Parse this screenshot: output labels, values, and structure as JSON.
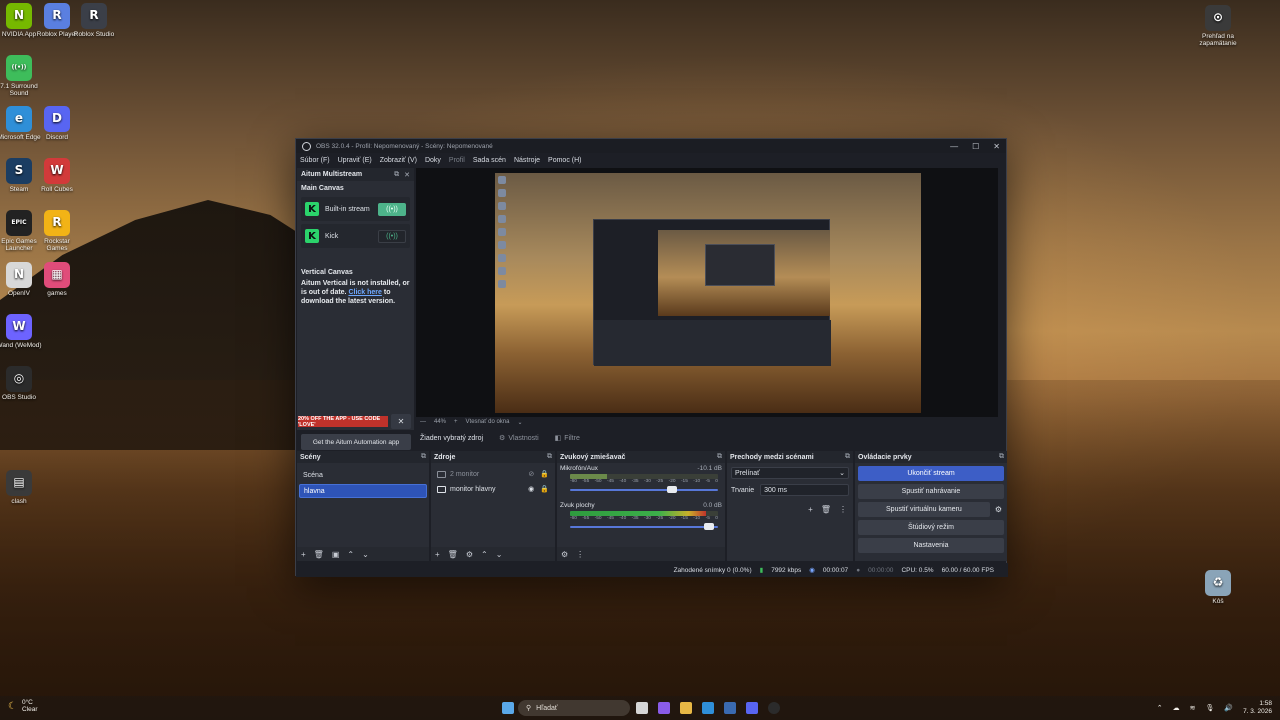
{
  "desktop": {
    "icons_left": [
      {
        "label": "NVIDIA App",
        "glyph": "N",
        "color": "#76b900"
      },
      {
        "label": "Roblox Player",
        "glyph": "R",
        "color": "#5a7fe0"
      },
      {
        "label": "Roblox Studio",
        "glyph": "R",
        "color": "#3b3f48"
      },
      {
        "label": "7.1 Surround Sound",
        "glyph": "((•))",
        "color": "#3ebd5b"
      },
      {
        "label": "Microsoft Edge",
        "glyph": "e",
        "color": "#2f8fd8"
      },
      {
        "label": "Discord",
        "glyph": "D",
        "color": "#5865f2"
      },
      {
        "label": "Steam",
        "glyph": "S",
        "color": "#1b3d62"
      },
      {
        "label": "Roll Cubes",
        "glyph": "W",
        "color": "#d23a3a"
      },
      {
        "label": "Epic Games Launcher",
        "glyph": "EPIC",
        "color": "#222222"
      },
      {
        "label": "Rockstar Games",
        "glyph": "R",
        "color": "#f2b316"
      },
      {
        "label": "OpenIV",
        "glyph": "N",
        "color": "#d8d8d8"
      },
      {
        "label": "games",
        "glyph": "▦",
        "color": "#e04c7a"
      },
      {
        "label": "Wand (WeMod)",
        "glyph": "W",
        "color": "#6d63ff"
      },
      {
        "label": "OBS Studio",
        "glyph": "◎",
        "color": "#2b2b2b"
      },
      {
        "label": "clash",
        "glyph": "▤",
        "color": "#3a3a3a"
      }
    ],
    "icons_right": [
      {
        "label": "Prehľad na zapamätanie",
        "glyph": "⊙",
        "color": "#3a3a3a"
      },
      {
        "label": "Kôš",
        "glyph": "♻",
        "color": "#8aa4b8"
      }
    ]
  },
  "obs": {
    "title": "OBS 32.0.4 - Profil: Nepomenovaný - Scény: Nepomenované",
    "window_controls": [
      "—",
      "☐",
      "✕"
    ],
    "menu": [
      "Súbor (F)",
      "Upraviť (E)",
      "Zobraziť (V)",
      "Doky",
      "Profil",
      "Sada scén",
      "Nástroje",
      "Pomoc (H)"
    ],
    "multistream": {
      "title": "Aitum Multistream",
      "main_canvas": "Main Canvas",
      "outputs": [
        {
          "name": "Built-in stream",
          "active": true,
          "live_icon": "((•))"
        },
        {
          "name": "Kick",
          "active": false,
          "live_icon": "((•))"
        }
      ],
      "vertical_canvas": "Vertical Canvas",
      "vertical_msg": "Aitum Vertical is not installed, or is out of date.",
      "link_text": "Click here",
      "link_rest": "to download the latest version.",
      "promo": "20% OFF THE APP - USE CODE 'LOVE'",
      "promo_close": "✕",
      "get_app": "Get the Aitum Automation app",
      "btns": [
        "⚙",
        "♥",
        "⟲"
      ]
    },
    "zoom": {
      "value": "44%",
      "fit": "Vtesnať do okna"
    },
    "source_bar": {
      "none": "Žiaden vybratý zdroj",
      "properties": "Vlastnosti",
      "filters": "Filtre"
    },
    "scenes": {
      "title": "Scény",
      "items": [
        "Scéna",
        "hlavna"
      ],
      "selected_index": 1,
      "foot": [
        "+",
        "🗑",
        "▣",
        "⌃",
        "⌄"
      ]
    },
    "sources": {
      "title": "Zdroje",
      "items": [
        {
          "name": "2 monitor",
          "hidden": true
        },
        {
          "name": "monitor hlavny",
          "hidden": false
        }
      ],
      "foot": [
        "+",
        "🗑",
        "⚙",
        "⌃",
        "⌄"
      ]
    },
    "mixer": {
      "title": "Zvukový zmiešavač",
      "channels": [
        {
          "name": "Mikrofón/Aux",
          "db": "-10.1 dB",
          "level": 0.25,
          "fader": 0.7
        },
        {
          "name": "Zvuk plochy",
          "db": "0.0 dB",
          "level": 0.92,
          "fader": 0.97
        }
      ],
      "scale": [
        "-60",
        "-55",
        "-50",
        "-45",
        "-40",
        "-35",
        "-30",
        "-25",
        "-20",
        "-15",
        "-10",
        "-5",
        "0"
      ],
      "foot": [
        "⚙",
        "⋮"
      ]
    },
    "transitions": {
      "title": "Prechody medzi scénami",
      "type": "Prelínať",
      "duration_label": "Trvanie",
      "duration": "300 ms",
      "foot": [
        "+",
        "🗑",
        "⋮"
      ]
    },
    "controls": {
      "title": "Ovládacie prvky",
      "buttons": [
        "Ukončiť stream",
        "Spustiť nahrávanie",
        "Spustiť virtuálnu kameru",
        "Štúdiový režim",
        "Nastavenia"
      ]
    },
    "status": {
      "dropped": "Zahodené snímky 0 (0.0%)",
      "bitrate": "7992 kbps",
      "stream_time": "00:00:07",
      "rec_time": "00:00:00",
      "cpu": "CPU: 0.5%",
      "fps": "60.00 / 60.00 FPS"
    }
  },
  "taskbar": {
    "weather_temp": "0°C",
    "weather_desc": "Clear",
    "search": "Hľadať",
    "time": "1:58",
    "date": "7. 3. 2026"
  }
}
